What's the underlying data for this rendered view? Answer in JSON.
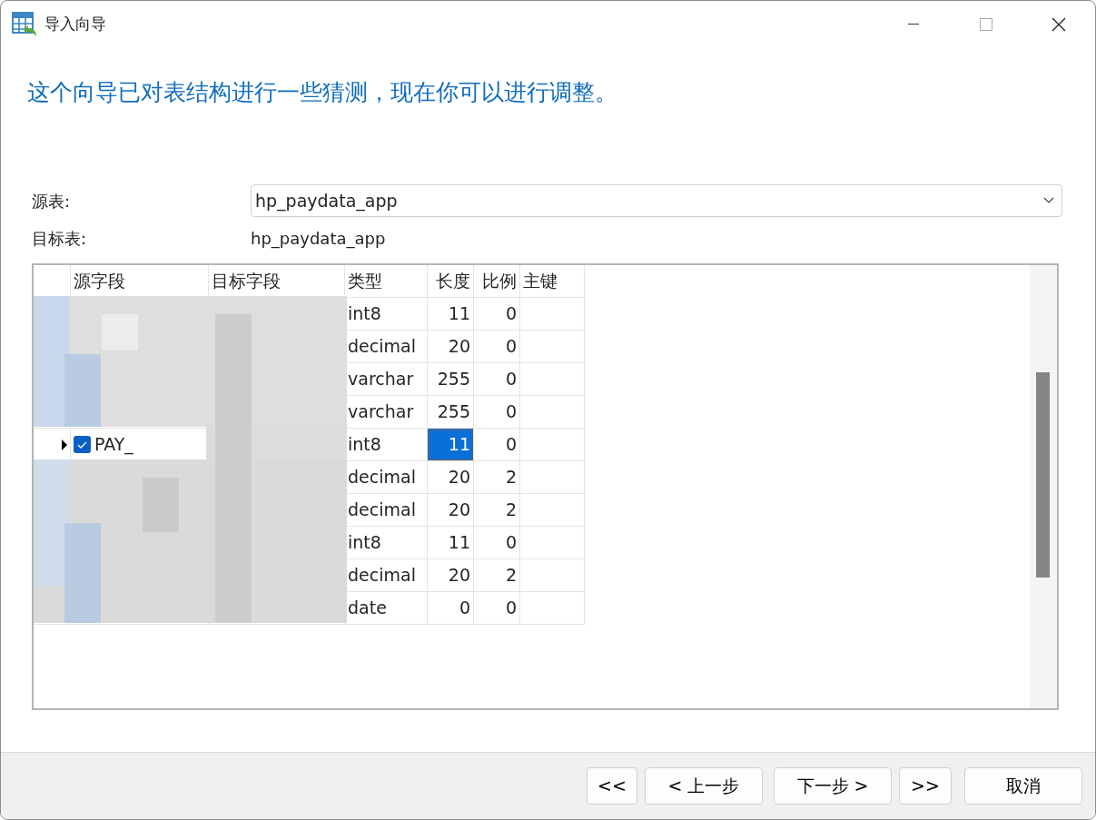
{
  "window": {
    "title": "导入向导"
  },
  "heading": "这个向导已对表结构进行一些猜测，现在你可以进行调整。",
  "source_table": {
    "label": "源表:",
    "value": "hp_paydata_app"
  },
  "target_table": {
    "label": "目标表:",
    "value": "hp_paydata_app"
  },
  "table": {
    "columns": [
      "源字段",
      "目标字段",
      "类型",
      "长度",
      "比例",
      "主键"
    ],
    "rows": [
      {
        "selected": false,
        "type": "int8",
        "length": "11",
        "scale": "0"
      },
      {
        "selected": false,
        "type": "decimal",
        "length": "20",
        "scale": "0"
      },
      {
        "selected": false,
        "type": "varchar",
        "length": "255",
        "scale": "0"
      },
      {
        "selected": false,
        "type": "varchar",
        "length": "255",
        "scale": "0"
      },
      {
        "selected": true,
        "source": {
          "checked": true,
          "name": "PAY_"
        },
        "type": "int8",
        "length": "11",
        "scale": "0"
      },
      {
        "selected": false,
        "type": "decimal",
        "length": "20",
        "scale": "2"
      },
      {
        "selected": false,
        "type": "decimal",
        "length": "20",
        "scale": "2"
      },
      {
        "selected": false,
        "type": "int8",
        "length": "11",
        "scale": "0"
      },
      {
        "selected": false,
        "type": "decimal",
        "length": "20",
        "scale": "2"
      },
      {
        "selected": false,
        "type": "date",
        "length": "0",
        "scale": "0"
      }
    ]
  },
  "buttons": [
    {
      "label": "<<",
      "kind": "nav"
    },
    {
      "label": "< 上一步",
      "kind": "nav"
    },
    {
      "label": "下一步 >",
      "kind": "nav"
    },
    {
      "label": ">>",
      "kind": "nav"
    },
    {
      "label": "取消",
      "kind": "cancel"
    }
  ]
}
